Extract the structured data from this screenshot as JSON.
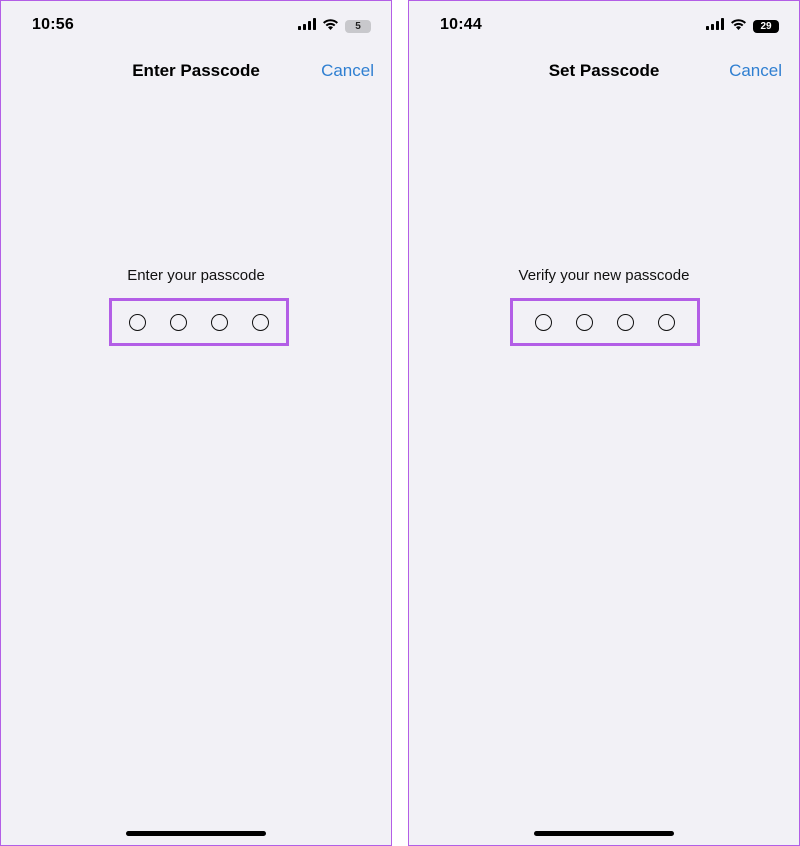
{
  "screens": [
    {
      "status": {
        "time": "10:56",
        "battery": "5"
      },
      "nav": {
        "title": "Enter Passcode",
        "cancel_label": "Cancel"
      },
      "prompt": "Enter your passcode",
      "passcode_digits_entered": 0,
      "passcode_length": 4
    },
    {
      "status": {
        "time": "10:44",
        "battery": "29"
      },
      "nav": {
        "title": "Set Passcode",
        "cancel_label": "Cancel"
      },
      "prompt": "Verify your new passcode",
      "passcode_digits_entered": 0,
      "passcode_length": 4
    }
  ],
  "colors": {
    "highlight": "#b35ee6",
    "link": "#2f7fd1",
    "background": "#f2f1f6"
  },
  "icons": [
    "cellular-signal-icon",
    "wifi-icon",
    "battery-icon"
  ]
}
